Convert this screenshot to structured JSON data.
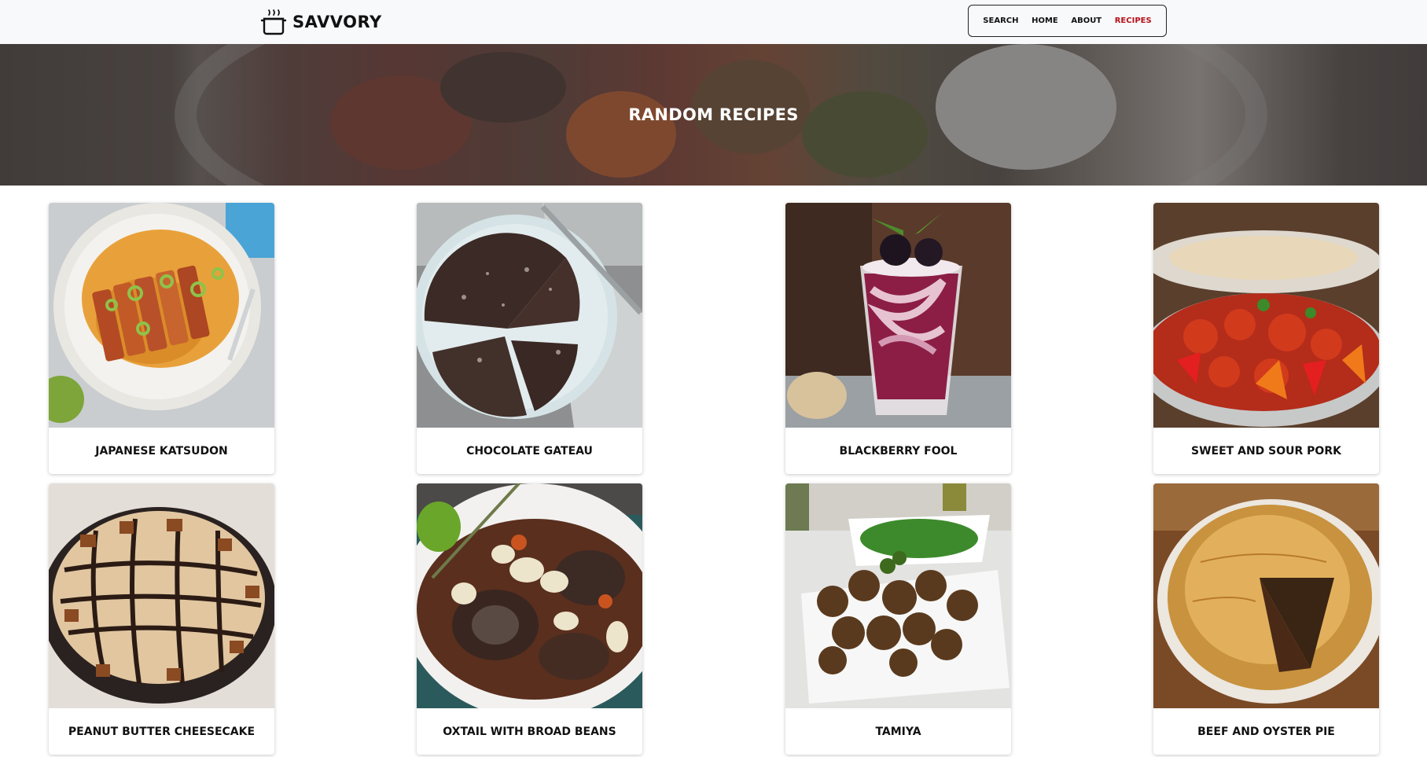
{
  "app": {
    "brand_name": "SAVVORY",
    "logo_icon": "cooking-pot-icon"
  },
  "nav": {
    "items": [
      {
        "label": "SEARCH",
        "active": false
      },
      {
        "label": "HOME",
        "active": false
      },
      {
        "label": "ABOUT",
        "active": false
      },
      {
        "label": "RECIPES",
        "active": true
      }
    ],
    "active_color": "#b5121b"
  },
  "hero": {
    "title": "RANDOM RECIPES"
  },
  "recipes": [
    {
      "name": "JAPANESE KATSUDON",
      "image": "katsudon-photo"
    },
    {
      "name": "CHOCOLATE GATEAU",
      "image": "chocolate-cake-photo"
    },
    {
      "name": "BLACKBERRY FOOL",
      "image": "blackberry-dessert-photo"
    },
    {
      "name": "SWEET AND SOUR PORK",
      "image": "sweet-sour-pork-photo"
    },
    {
      "name": "PEANUT BUTTER CHEESECAKE",
      "image": "cheesecake-photo"
    },
    {
      "name": "OXTAIL WITH BROAD BEANS",
      "image": "oxtail-stew-photo"
    },
    {
      "name": "TAMIYA",
      "image": "falafel-photo"
    },
    {
      "name": "BEEF AND OYSTER PIE",
      "image": "pie-photo"
    }
  ]
}
